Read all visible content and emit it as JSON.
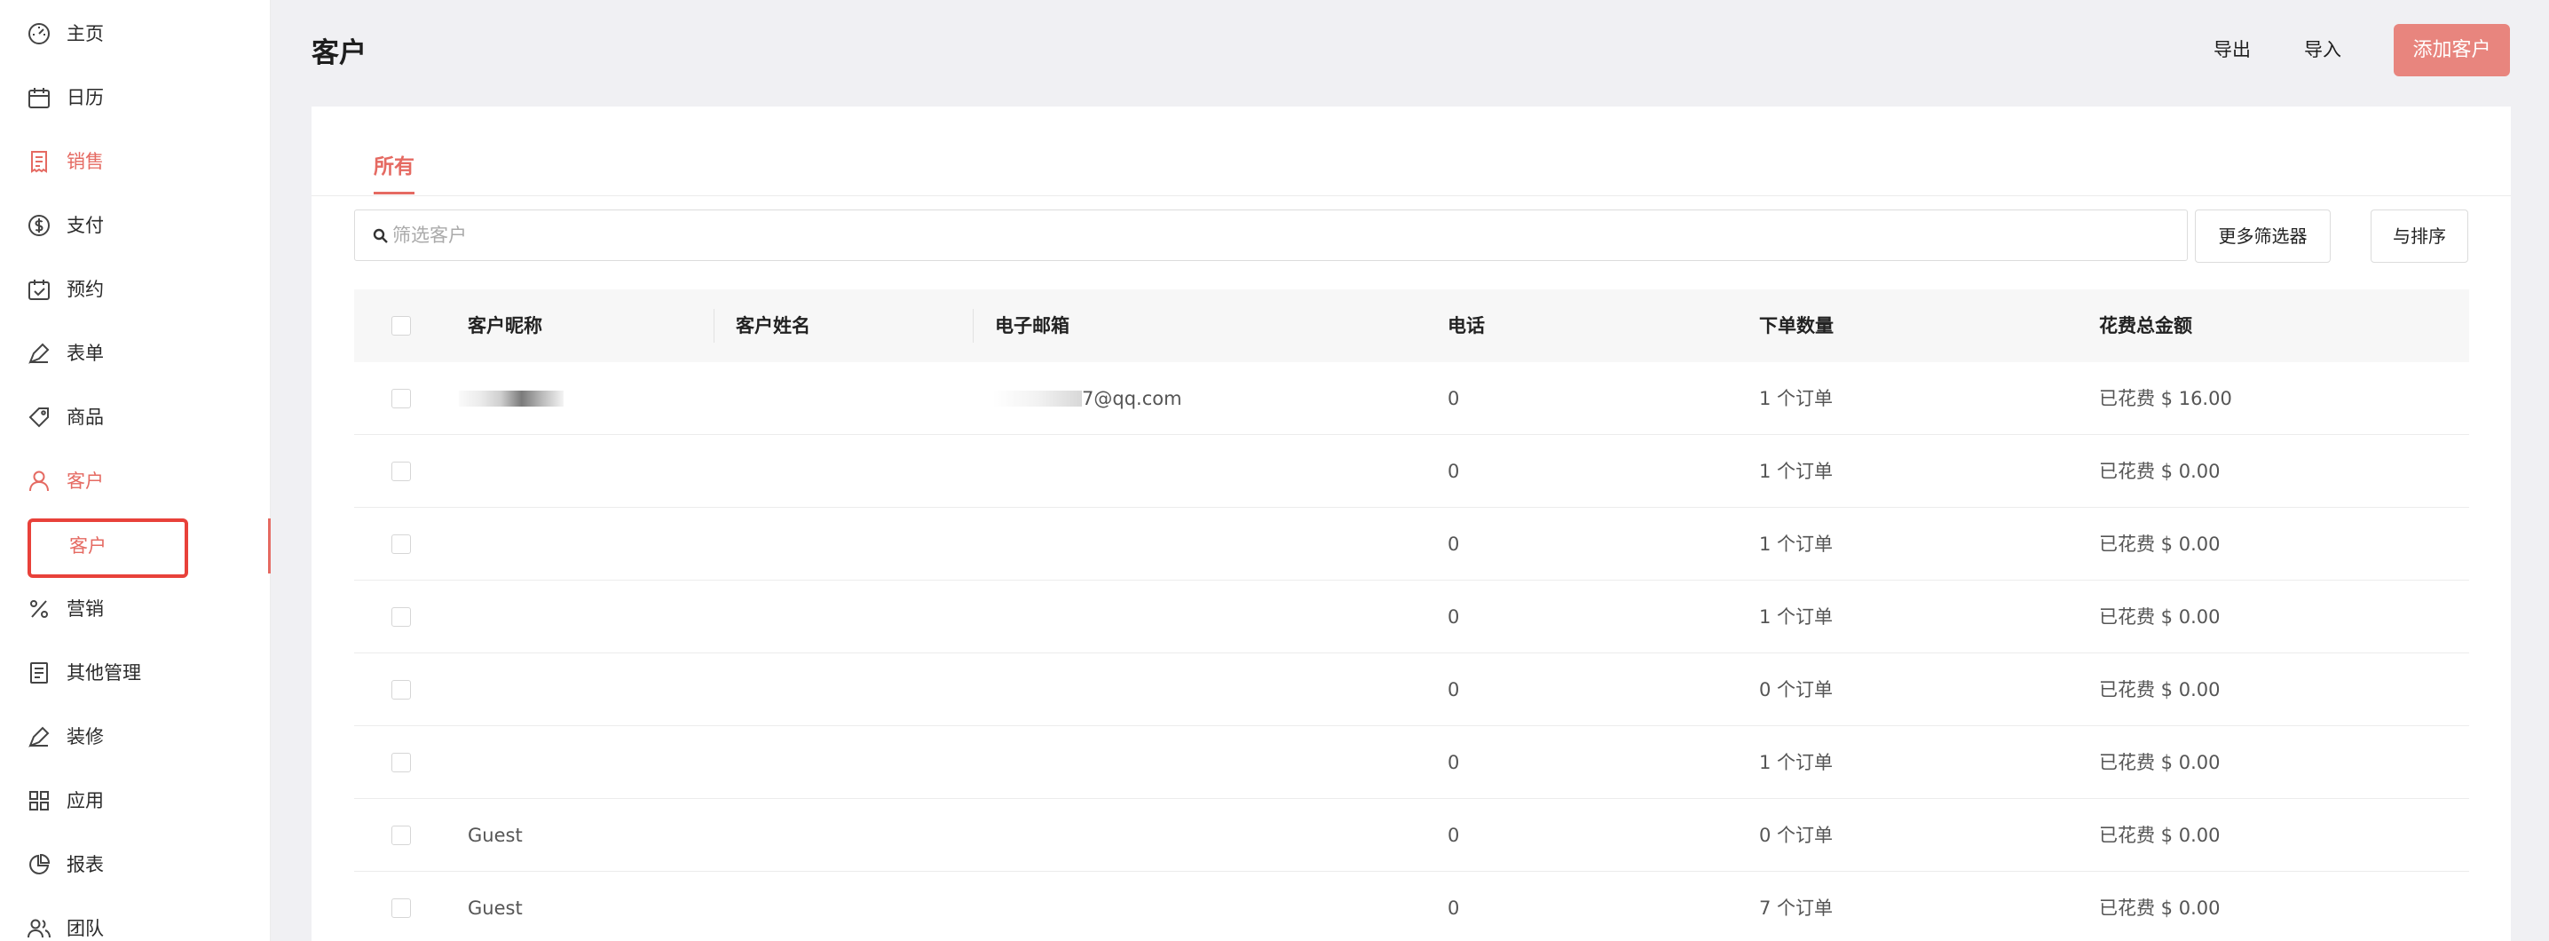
{
  "sidebar": {
    "items": [
      {
        "label": "主页",
        "icon": "dashboard-icon"
      },
      {
        "label": "日历",
        "icon": "calendar-icon"
      },
      {
        "label": "销售",
        "icon": "sales-receipt-icon"
      },
      {
        "label": "支付",
        "icon": "dollar-circle-icon"
      },
      {
        "label": "预约",
        "icon": "calendar-check-icon"
      },
      {
        "label": "表单",
        "icon": "form-pen-icon"
      },
      {
        "label": "商品",
        "icon": "tag-icon"
      },
      {
        "label": "客户",
        "icon": "user-icon"
      },
      {
        "label": "营销",
        "icon": "percent-icon"
      },
      {
        "label": "其他管理",
        "icon": "document-icon"
      },
      {
        "label": "装修",
        "icon": "paint-brush-icon"
      },
      {
        "label": "应用",
        "icon": "apps-grid-icon"
      },
      {
        "label": "报表",
        "icon": "pie-chart-icon"
      },
      {
        "label": "团队",
        "icon": "team-icon"
      }
    ],
    "sub_item_label": "客户",
    "accent_color": "#e56a62"
  },
  "header": {
    "title": "客户",
    "export_label": "导出",
    "import_label": "导入",
    "add_label": "添加客户"
  },
  "tabs": [
    {
      "label": "所有"
    }
  ],
  "search": {
    "placeholder": "筛选客户"
  },
  "toolbar": {
    "more_filters": "更多筛选器",
    "sort": "与排序"
  },
  "table": {
    "columns": [
      "客户昵称",
      "客户姓名",
      "电子邮箱",
      "电话",
      "下单数量",
      "花费总金额"
    ],
    "rows": [
      {
        "nickname": "",
        "name": "",
        "email": "7@qq.com",
        "phone": "0",
        "orders": "1 个订单",
        "spent": "已花费 $ 16.00"
      },
      {
        "nickname": "",
        "name": "",
        "email": "",
        "phone": "0",
        "orders": "1 个订单",
        "spent": "已花费 $ 0.00"
      },
      {
        "nickname": "",
        "name": "",
        "email": "",
        "phone": "0",
        "orders": "1 个订单",
        "spent": "已花费 $ 0.00"
      },
      {
        "nickname": "",
        "name": "",
        "email": "",
        "phone": "0",
        "orders": "1 个订单",
        "spent": "已花费 $ 0.00"
      },
      {
        "nickname": "",
        "name": "",
        "email": "",
        "phone": "0",
        "orders": "0 个订单",
        "spent": "已花费 $ 0.00"
      },
      {
        "nickname": "",
        "name": "",
        "email": "",
        "phone": "0",
        "orders": "1 个订单",
        "spent": "已花费 $ 0.00"
      },
      {
        "nickname": "Guest",
        "name": "",
        "email": "",
        "phone": "0",
        "orders": "0 个订单",
        "spent": "已花费 $ 0.00"
      },
      {
        "nickname": "Guest",
        "name": "",
        "email": "",
        "phone": "0",
        "orders": "7 个订单",
        "spent": "已花费 $ 0.00"
      }
    ]
  }
}
